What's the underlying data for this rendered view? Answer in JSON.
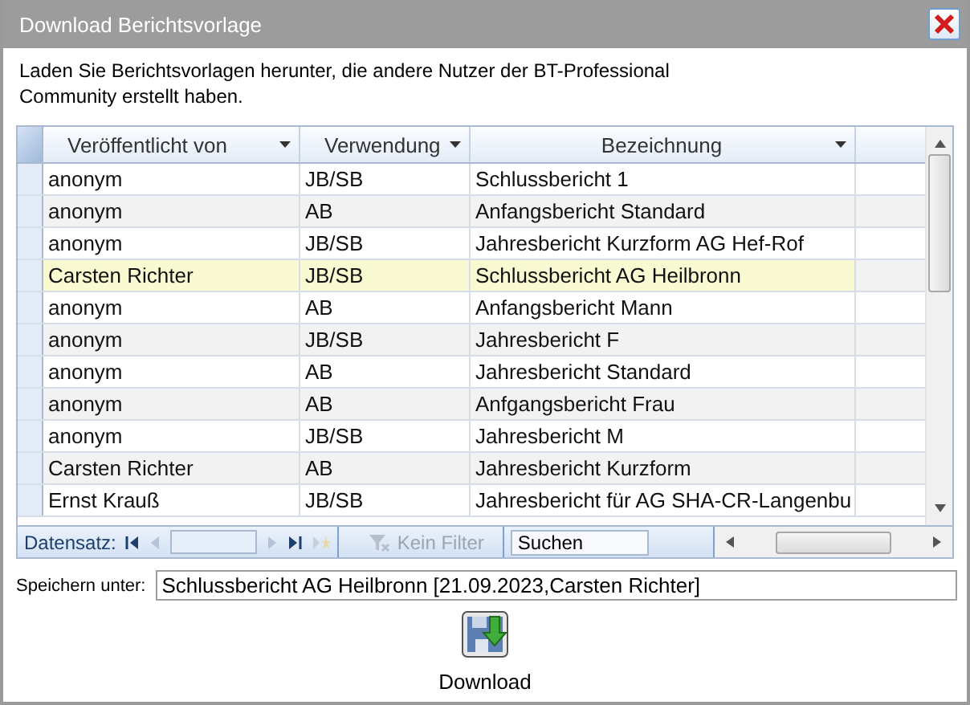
{
  "window": {
    "title": "Download Berichtsvorlage"
  },
  "intro": "Laden Sie Berichtsvorlagen herunter, die andere Nutzer der BT-Professional Community erstellt haben.",
  "table": {
    "columns": [
      {
        "label": "Veröffentlicht von"
      },
      {
        "label": "Verwendung"
      },
      {
        "label": "Bezeichnung"
      }
    ],
    "rows": [
      {
        "cells": [
          "anonym",
          "JB/SB",
          "Schlussbericht 1"
        ],
        "selected": false
      },
      {
        "cells": [
          "anonym",
          "AB",
          "Anfangsbericht Standard"
        ],
        "selected": false
      },
      {
        "cells": [
          "anonym",
          "JB/SB",
          "Jahresbericht Kurzform AG Hef-Rof"
        ],
        "selected": false
      },
      {
        "cells": [
          "Carsten Richter",
          "JB/SB",
          "Schlussbericht AG Heilbronn"
        ],
        "selected": true
      },
      {
        "cells": [
          "anonym",
          "AB",
          "Anfangsbericht Mann"
        ],
        "selected": false
      },
      {
        "cells": [
          "anonym",
          "JB/SB",
          "Jahresbericht F"
        ],
        "selected": false
      },
      {
        "cells": [
          "anonym",
          "AB",
          "Jahresbericht Standard"
        ],
        "selected": false
      },
      {
        "cells": [
          "anonym",
          "AB",
          "Anfgangsbericht Frau"
        ],
        "selected": false
      },
      {
        "cells": [
          "anonym",
          "JB/SB",
          "Jahresbericht M"
        ],
        "selected": false
      },
      {
        "cells": [
          "Carsten Richter",
          "AB",
          "Jahresbericht Kurzform"
        ],
        "selected": false
      },
      {
        "cells": [
          "Ernst Krauß",
          "JB/SB",
          "Jahresbericht für AG SHA-CR-Langenbu"
        ],
        "selected": false
      }
    ]
  },
  "navigator": {
    "label": "Datensatz:",
    "filter": {
      "label": "Kein Filter",
      "disabled": true
    },
    "search": {
      "value": "Suchen"
    }
  },
  "save_as": {
    "label": "Speichern unter:",
    "value": "Schlussbericht AG Heilbronn [21.09.2023,Carsten Richter]"
  },
  "download_button": {
    "label": "Download"
  }
}
